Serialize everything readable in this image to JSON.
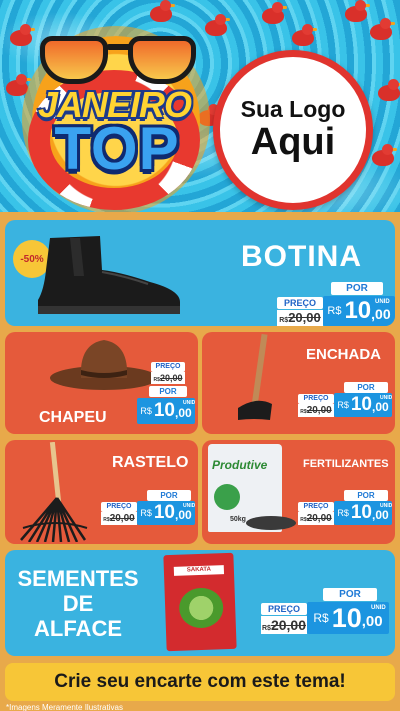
{
  "header": {
    "title_line1": "JANEIRO",
    "title_line2": "TOP",
    "logo_line1": "Sua Logo",
    "logo_line2": "Aqui"
  },
  "products": {
    "botina": {
      "name": "BOTINA",
      "badge": "-50%",
      "price_label": "PREÇO",
      "old_prefix": "R$",
      "old_price": "20,00",
      "por_label": "POR",
      "currency": "R$",
      "price_int": "10",
      "price_cents": ",00",
      "unit": "UNID"
    },
    "chapeu": {
      "name": "CHAPEU",
      "price_label": "PREÇO",
      "old_prefix": "R$",
      "old_price": "20,00",
      "por_label": "POR",
      "currency": "R$",
      "price_int": "10",
      "price_cents": ",00",
      "unit": "UNID"
    },
    "enchada": {
      "name": "ENCHADA",
      "price_label": "PREÇO",
      "old_prefix": "R$",
      "old_price": "20,00",
      "por_label": "POR",
      "currency": "R$",
      "price_int": "10",
      "price_cents": ",00",
      "unit": "UNID"
    },
    "rastelo": {
      "name": "RASTELO",
      "price_label": "PREÇO",
      "old_prefix": "R$",
      "old_price": "20,00",
      "por_label": "POR",
      "currency": "R$",
      "price_int": "10",
      "price_cents": ",00",
      "unit": "UNID"
    },
    "fertilizantes": {
      "name": "FERTILIZANTES",
      "bag_brand": "Produtive",
      "bag_weight": "50kg",
      "price_label": "PREÇO",
      "old_prefix": "R$",
      "old_price": "20,00",
      "por_label": "POR",
      "currency": "R$",
      "price_int": "10",
      "price_cents": ",00",
      "unit": "UNID"
    },
    "sementes": {
      "name_l1": "SEMENTES",
      "name_l2": "DE",
      "name_l3": "ALFACE",
      "pack_brand": "SAKATA",
      "price_label": "PREÇO",
      "old_prefix": "R$",
      "old_price": "20,00",
      "por_label": "POR",
      "currency": "R$",
      "price_int": "10",
      "price_cents": ",00",
      "unit": "UNID"
    }
  },
  "footer": {
    "banner": "Crie seu encarte com este tema!",
    "disclaimer": "*Imagens Meramente Ilustrativas"
  },
  "colors": {
    "card_blue": "#3ab3e0",
    "card_orange": "#e55a3b",
    "price_blue": "#1c95e0",
    "banner_yellow": "#f7c637",
    "logo_red": "#e0342e"
  }
}
